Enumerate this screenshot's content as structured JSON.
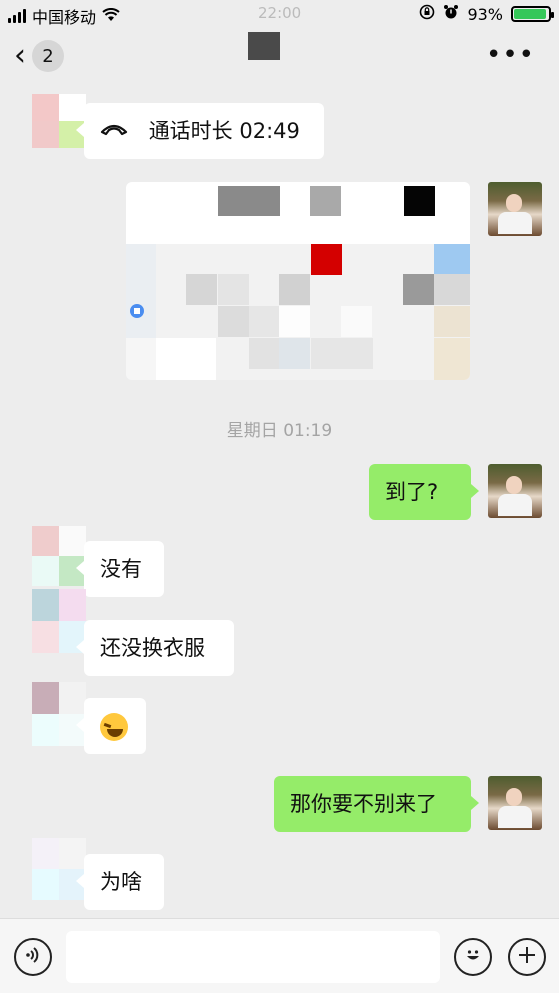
{
  "status_bar": {
    "carrier": "中国移动",
    "time": "22:00",
    "battery_percent": "93%",
    "battery_level": 0.93
  },
  "nav": {
    "back_badge": "2",
    "more": "•••"
  },
  "messages": {
    "call": {
      "text": "通话时长 02:49"
    },
    "timestamp": "星期日 01:19",
    "m1": "到了?",
    "m2": "没有",
    "m3": "还没换衣服",
    "m5": "那你要不别来了",
    "m6": "为啥"
  },
  "input_bar": {
    "placeholder": ""
  },
  "colors": {
    "bubble_green": "#95ec69",
    "background": "#ededed",
    "battery_green": "#35c759"
  }
}
